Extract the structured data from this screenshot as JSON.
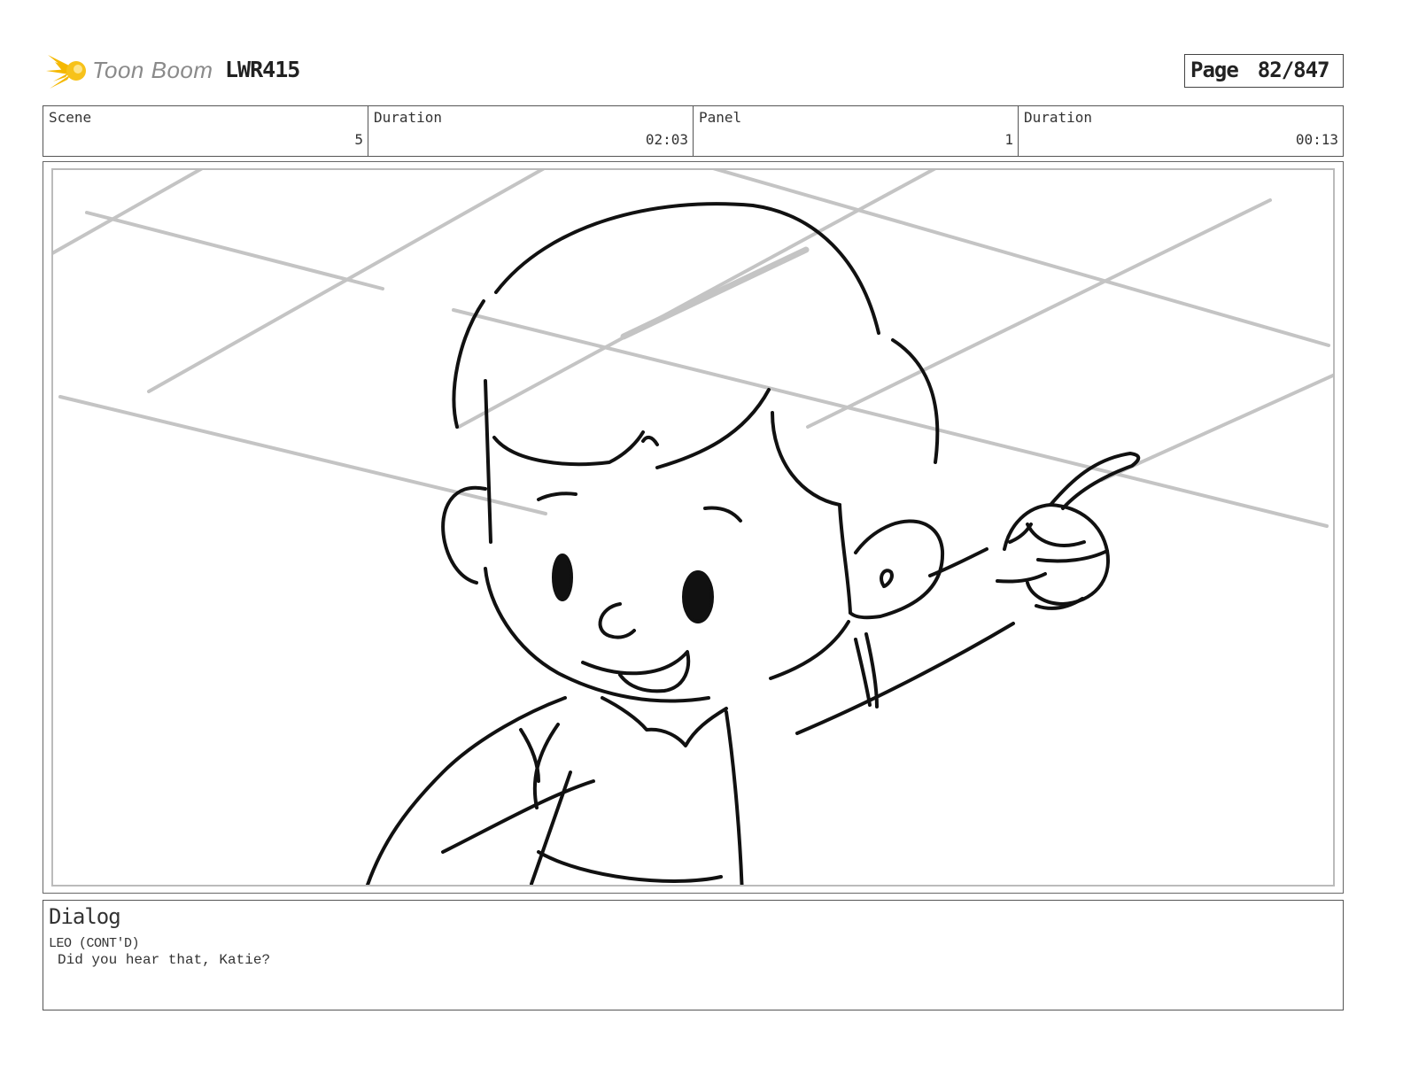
{
  "header": {
    "logo_text": "Toon Boom",
    "project_id": "LWR415",
    "page_label": "Page",
    "page_number": "82/847"
  },
  "info": {
    "scene_label": "Scene",
    "scene_value": "5",
    "scene_duration_label": "Duration",
    "scene_duration_value": "02:03",
    "panel_label": "Panel",
    "panel_value": "1",
    "panel_duration_label": "Duration",
    "panel_duration_value": "00:13"
  },
  "dialog": {
    "title": "Dialog",
    "speaker": "LEO (CONT'D)",
    "line": "Did you hear that, Katie?"
  },
  "colors": {
    "logo_star": "#f5b800",
    "logo_text": "#8a8a8a",
    "sketch_line": "#111111",
    "grid_line": "#c4c4c4"
  }
}
